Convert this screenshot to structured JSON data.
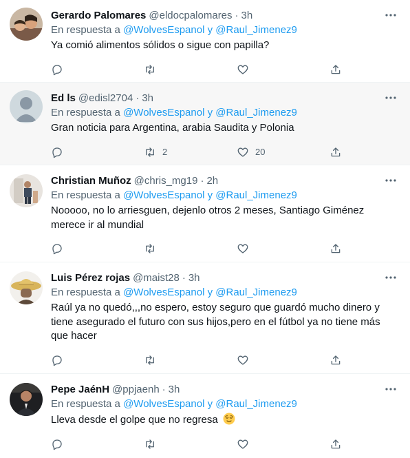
{
  "reply_prefix": "En respuesta a",
  "reply_mention_1": "@WolvesEspanol",
  "reply_conj": "y",
  "reply_mention_2": "@Raul_Jimenez9",
  "tweets": [
    {
      "name": "Gerardo Palomares",
      "handle": "@eldocpalomares",
      "time": "3h",
      "text": "Ya comió alimentos sólidos o sigue con papilla?",
      "retweets": "",
      "likes": ""
    },
    {
      "name": "Ed ls",
      "handle": "@edisl2704",
      "time": "3h",
      "text": "Gran noticia para Argentina, arabia Saudita y Polonia",
      "retweets": "2",
      "likes": "20"
    },
    {
      "name": "Christian Muñoz",
      "handle": "@chris_mg19",
      "time": "2h",
      "text": "Nooooo, no lo arriesguen, dejenlo otros 2 meses, Santiago Giménez merece ir al mundial",
      "retweets": "",
      "likes": ""
    },
    {
      "name": "Luis Pérez rojas",
      "handle": "@maist28",
      "time": "3h",
      "text": "Raúl ya no quedó,,,no espero, estoy seguro que guardó mucho dinero y tiene asegurado el futuro con sus hijos,pero en el fútbol ya no tiene más que hacer",
      "retweets": "",
      "likes": ""
    },
    {
      "name": "Pepe JaénH",
      "handle": "@ppjaenh",
      "time": "3h",
      "text": "Lleva desde el golpe que no regresa",
      "retweets": "",
      "likes": ""
    }
  ]
}
